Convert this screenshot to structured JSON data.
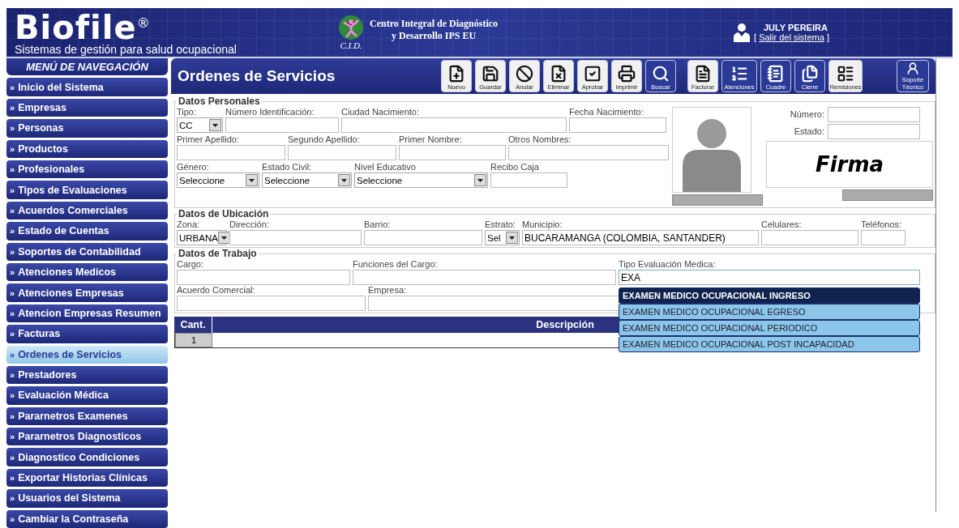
{
  "header": {
    "brand": "Biofile",
    "brand_mark": "®",
    "tagline": "Sistemas de gestión para salud ocupacional",
    "partner": {
      "initials": "C.I.D.",
      "name_lines": [
        "Centro Integral de Diagnóstico",
        "y Desarrollo IPS EU"
      ]
    },
    "user": {
      "name": "JULY PEREIRA",
      "bracket_open": "[",
      "logout": "Salir del sistema",
      "bracket_close": "]"
    }
  },
  "sidebar": {
    "title": "MENÚ DE NAVEGACIÓN",
    "bullet": "»",
    "items": [
      {
        "label": "Inicio del Sistema",
        "selected": false
      },
      {
        "label": "Empresas",
        "selected": false
      },
      {
        "label": "Personas",
        "selected": false
      },
      {
        "label": "Productos",
        "selected": false
      },
      {
        "label": "Profesionales",
        "selected": false
      },
      {
        "label": "Tipos de Evaluaciones",
        "selected": false
      },
      {
        "label": "Acuerdos Comerciales",
        "selected": false
      },
      {
        "label": "Estado de Cuentas",
        "selected": false
      },
      {
        "label": "Soportes de Contabilidad",
        "selected": false
      },
      {
        "label": "Atenciones Medicos",
        "selected": false
      },
      {
        "label": "Atenciones Empresas",
        "selected": false
      },
      {
        "label": "Atencion Empresas Resumen",
        "selected": false
      },
      {
        "label": "Facturas",
        "selected": false
      },
      {
        "label": "Ordenes de Servicios",
        "selected": true
      },
      {
        "label": "Prestadores",
        "selected": false
      },
      {
        "label": "Evaluación Médica",
        "selected": false
      },
      {
        "label": "Pararnetros Examenes",
        "selected": false
      },
      {
        "label": "Pararnetros Diagnosticos",
        "selected": false
      },
      {
        "label": "Diagnostico Condiciones",
        "selected": false
      },
      {
        "label": "Exportar Historias Clínicas",
        "selected": false
      },
      {
        "label": "Usuarios del Sistema",
        "selected": false
      },
      {
        "label": "Cambiar la Contraseña",
        "selected": false
      }
    ]
  },
  "page_title": "Ordenes de Servicios",
  "toolbar": [
    {
      "label": "Nuevo",
      "kind": "light"
    },
    {
      "label": "Guardar",
      "kind": "light"
    },
    {
      "label": "Anular",
      "kind": "light"
    },
    {
      "label": "Eliminar",
      "kind": "light"
    },
    {
      "label": "Aprobar",
      "kind": "light"
    },
    {
      "label": "Imprimir",
      "kind": "light"
    },
    {
      "label": "Buscar",
      "kind": "dark"
    },
    {
      "label": "Facturar",
      "kind": "light"
    },
    {
      "label": "Atenciones",
      "kind": "dark"
    },
    {
      "label": "Cuadre",
      "kind": "dark"
    },
    {
      "label": "Cierre",
      "kind": "dark"
    },
    {
      "label": "Remisiones",
      "kind": "light"
    },
    {
      "label": "Soporte Técnico",
      "kind": "dark"
    }
  ],
  "personal": {
    "legend": "Datos Personales",
    "rows": [
      [
        {
          "label": "Tipo:",
          "kind": "select",
          "value": "CC"
        },
        {
          "label": "Número Identificación:",
          "kind": "text"
        },
        {
          "label": "Ciudad Nacimiento:",
          "kind": "text"
        },
        {
          "label": "Fecha Nacimiento:",
          "kind": "text"
        }
      ],
      [
        {
          "label": "Primer Apellido:",
          "kind": "text"
        },
        {
          "label": "Segundo Apellido:",
          "kind": "text"
        },
        {
          "label": "Primer Nombre:",
          "kind": "text"
        },
        {
          "label": "Otros Nombres:",
          "kind": "text"
        }
      ],
      [
        {
          "label": "Género:",
          "kind": "select",
          "value": "Seleccione"
        },
        {
          "label": "Estado Civil:",
          "kind": "select",
          "value": "Seleccione"
        },
        {
          "label": "Nivel Educativo",
          "kind": "select",
          "value": "Seleccione"
        },
        {
          "label": "Recibo Caja",
          "kind": "text"
        }
      ]
    ],
    "side_fields": [
      {
        "label": "Número:"
      },
      {
        "label": "Estado:"
      }
    ],
    "signature": "Firma"
  },
  "location": {
    "legend": "Datos de Ubicación",
    "fields": [
      {
        "label": "Zona:",
        "kind": "select",
        "value": "URBANA"
      },
      {
        "label": "Dirección:",
        "kind": "text"
      },
      {
        "label": "Barrio:",
        "kind": "text"
      },
      {
        "label": "Estrato:",
        "kind": "select",
        "value": "Sel"
      },
      {
        "label": "Municipio:",
        "kind": "text",
        "value": "BUCARAMANGA (COLOMBIA, SANTANDER)"
      },
      {
        "label": "Celulares:",
        "kind": "text"
      },
      {
        "label": "Teléfonos:",
        "kind": "text"
      }
    ]
  },
  "work": {
    "legend": "Datos de Trabajo",
    "rows": [
      [
        {
          "label": "Cargo:",
          "kind": "text"
        },
        {
          "label": "Funciones del Cargo:",
          "kind": "text"
        },
        {
          "label": "Tipo Evaluación Medica:",
          "kind": "text",
          "value": "EXA"
        }
      ],
      [
        {
          "label": "Acuerdo Comercial:",
          "kind": "text"
        },
        {
          "label": "Empresa:",
          "kind": "text"
        }
      ]
    ],
    "suggestions": [
      {
        "label": "EXAMEN MEDICO OCUPACIONAL INGRESO",
        "selected": true
      },
      {
        "label": "EXAMEN MEDICO OCUPACIONAL EGRESO",
        "selected": false
      },
      {
        "label": "EXAMEN MEDICO OCUPACIONAL PERIODICO",
        "selected": false
      },
      {
        "label": "EXAMEN MEDICO OCUPACIONAL POST INCAPACIDAD",
        "selected": false
      }
    ]
  },
  "items_table": {
    "columns": [
      "Cant.",
      "Descripción"
    ],
    "rows": [
      [
        "1"
      ]
    ]
  }
}
